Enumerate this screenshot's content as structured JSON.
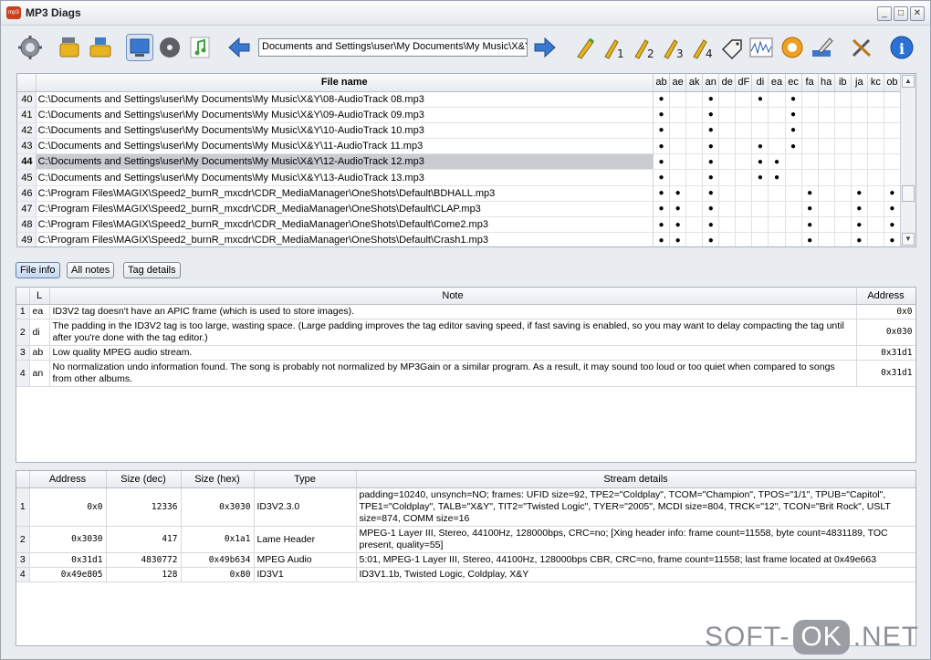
{
  "window": {
    "title": "MP3 Diags",
    "app_icon": "mp3",
    "min": "_",
    "max": "□",
    "close": "✕"
  },
  "toolbar": {
    "path": "Documents and Settings\\user\\My Documents\\My Music\\X&Y",
    "icons": [
      "gear-icon",
      "folder-scan-icon",
      "folder-open-icon",
      "monitor-icon",
      "cd-icon",
      "music-note-icon",
      "back-arrow-icon",
      "forward-arrow-icon",
      "tag-icon",
      "tag-1-icon",
      "tag-2-icon",
      "tag-3-icon",
      "tag-4-icon",
      "label-icon",
      "waveform-icon",
      "normalize-icon",
      "edit-icon",
      "tools-icon",
      "info-icon"
    ]
  },
  "files": {
    "header": "File name",
    "flag_headers": [
      "ab",
      "ae",
      "ak",
      "an",
      "de",
      "dF",
      "di",
      "ea",
      "ec",
      "fa",
      "ha",
      "ib",
      "ja",
      "kc",
      "ob"
    ],
    "rows": [
      {
        "num": "40",
        "name": "C:\\Documents and Settings\\user\\My Documents\\My Music\\X&Y\\08-AudioTrack 08.mp3",
        "flags": [
          "●",
          "",
          "",
          "●",
          "",
          "",
          "●",
          "",
          "●",
          "",
          "",
          "",
          "",
          "",
          ""
        ]
      },
      {
        "num": "41",
        "name": "C:\\Documents and Settings\\user\\My Documents\\My Music\\X&Y\\09-AudioTrack 09.mp3",
        "flags": [
          "●",
          "",
          "",
          "●",
          "",
          "",
          "",
          "",
          "●",
          "",
          "",
          "",
          "",
          "",
          ""
        ]
      },
      {
        "num": "42",
        "name": "C:\\Documents and Settings\\user\\My Documents\\My Music\\X&Y\\10-AudioTrack 10.mp3",
        "flags": [
          "●",
          "",
          "",
          "●",
          "",
          "",
          "",
          "",
          "●",
          "",
          "",
          "",
          "",
          "",
          ""
        ]
      },
      {
        "num": "43",
        "name": "C:\\Documents and Settings\\user\\My Documents\\My Music\\X&Y\\11-AudioTrack 11.mp3",
        "flags": [
          "●",
          "",
          "",
          "●",
          "",
          "",
          "●",
          "",
          "●",
          "",
          "",
          "",
          "",
          "",
          ""
        ]
      },
      {
        "num": "44",
        "name": "C:\\Documents and Settings\\user\\My Documents\\My Music\\X&Y\\12-AudioTrack 12.mp3",
        "flags": [
          "●",
          "",
          "",
          "●",
          "",
          "",
          "●",
          "●",
          "",
          "",
          "",
          "",
          "",
          "",
          ""
        ]
      },
      {
        "num": "45",
        "name": "C:\\Documents and Settings\\user\\My Documents\\My Music\\X&Y\\13-AudioTrack 13.mp3",
        "flags": [
          "●",
          "",
          "",
          "●",
          "",
          "",
          "●",
          "●",
          "",
          "",
          "",
          "",
          "",
          "",
          ""
        ]
      },
      {
        "num": "46",
        "name": "C:\\Program Files\\MAGIX\\Speed2_burnR_mxcdr\\CDR_MediaManager\\OneShots\\Default\\BDHALL.mp3",
        "flags": [
          "●",
          "●",
          "",
          "●",
          "",
          "",
          "",
          "",
          "",
          "●",
          "",
          "",
          "●",
          "",
          "●"
        ]
      },
      {
        "num": "47",
        "name": "C:\\Program Files\\MAGIX\\Speed2_burnR_mxcdr\\CDR_MediaManager\\OneShots\\Default\\CLAP.mp3",
        "flags": [
          "●",
          "●",
          "",
          "●",
          "",
          "",
          "",
          "",
          "",
          "●",
          "",
          "",
          "●",
          "",
          "●"
        ]
      },
      {
        "num": "48",
        "name": "C:\\Program Files\\MAGIX\\Speed2_burnR_mxcdr\\CDR_MediaManager\\OneShots\\Default\\Come2.mp3",
        "flags": [
          "●",
          "●",
          "",
          "●",
          "",
          "",
          "",
          "",
          "",
          "●",
          "",
          "",
          "●",
          "",
          "●"
        ]
      },
      {
        "num": "49",
        "name": "C:\\Program Files\\MAGIX\\Speed2_burnR_mxcdr\\CDR_MediaManager\\OneShots\\Default\\Crash1.mp3",
        "flags": [
          "●",
          "●",
          "",
          "●",
          "",
          "",
          "",
          "",
          "",
          "●",
          "",
          "",
          "●",
          "",
          "●"
        ]
      }
    ],
    "selected_index": 4,
    "scroll_up": "▲",
    "scroll_down": "▼"
  },
  "tabs": [
    {
      "label": "File info",
      "active": true
    },
    {
      "label": "All notes",
      "active": false
    },
    {
      "label": "Tag details",
      "active": false
    }
  ],
  "notes": {
    "headers": [
      "",
      "L",
      "Note",
      "Address"
    ],
    "rows": [
      {
        "idx": "1",
        "l": "ea",
        "note": "ID3V2 tag doesn't have an APIC frame (which is used to store images).",
        "addr": "0x0"
      },
      {
        "idx": "2",
        "l": "di",
        "note": "The padding in the ID3V2 tag is too large, wasting space. (Large padding improves the tag editor saving speed, if fast saving is enabled, so you may want to delay compacting the tag until after you're done with the tag editor.)",
        "addr": "0x030"
      },
      {
        "idx": "3",
        "l": "ab",
        "note": "Low quality MPEG audio stream.",
        "addr": "0x31d1"
      },
      {
        "idx": "4",
        "l": "an",
        "note": "No normalization undo information found. The song is probably not normalized by MP3Gain or a similar program. As a result, it may sound too loud or too quiet when compared to songs from other albums.",
        "addr": "0x31d1"
      }
    ]
  },
  "streams": {
    "headers": [
      "",
      "Address",
      "Size (dec)",
      "Size (hex)",
      "Type",
      "Stream details"
    ],
    "rows": [
      {
        "idx": "1",
        "addr": "0x0",
        "dec": "12336",
        "hex": "0x3030",
        "type": "ID3V2.3.0",
        "details": "padding=10240, unsynch=NO; frames: UFID size=92, TPE2=\"Coldplay\", TCOM=\"Champion\", TPOS=\"1/1\", TPUB=\"Capitol\", TPE1=\"Coldplay\", TALB=\"X&Y\", TIT2=\"Twisted Logic\", TYER=\"2005\", MCDI size=804, TRCK=\"12\", TCON=\"Brit Rock\", USLT size=874, COMM size=16"
      },
      {
        "idx": "2",
        "addr": "0x3030",
        "dec": "417",
        "hex": "0x1a1",
        "type": "Lame Header",
        "details": "MPEG-1 Layer III, Stereo, 44100Hz, 128000bps, CRC=no; [Xing header info: frame count=11558, byte count=4831189, TOC present, quality=55]"
      },
      {
        "idx": "3",
        "addr": "0x31d1",
        "dec": "4830772",
        "hex": "0x49b634",
        "type": "MPEG Audio",
        "details": "5:01, MPEG-1 Layer III, Stereo, 44100Hz, 128000bps CBR, CRC=no, frame count=11558; last frame located at 0x49e663"
      },
      {
        "idx": "4",
        "addr": "0x49e805",
        "dec": "128",
        "hex": "0x80",
        "type": "ID3V1",
        "details": "ID3V1.1b, Twisted Logic, Coldplay, X&Y"
      }
    ]
  },
  "watermark": {
    "left": "SOFT-",
    "mid": "OK",
    "right": ".NET"
  },
  "colors": {
    "selected_row": "#c9ccd1",
    "accent": "#3a78d0",
    "window_bg": "#e9ecf1"
  }
}
